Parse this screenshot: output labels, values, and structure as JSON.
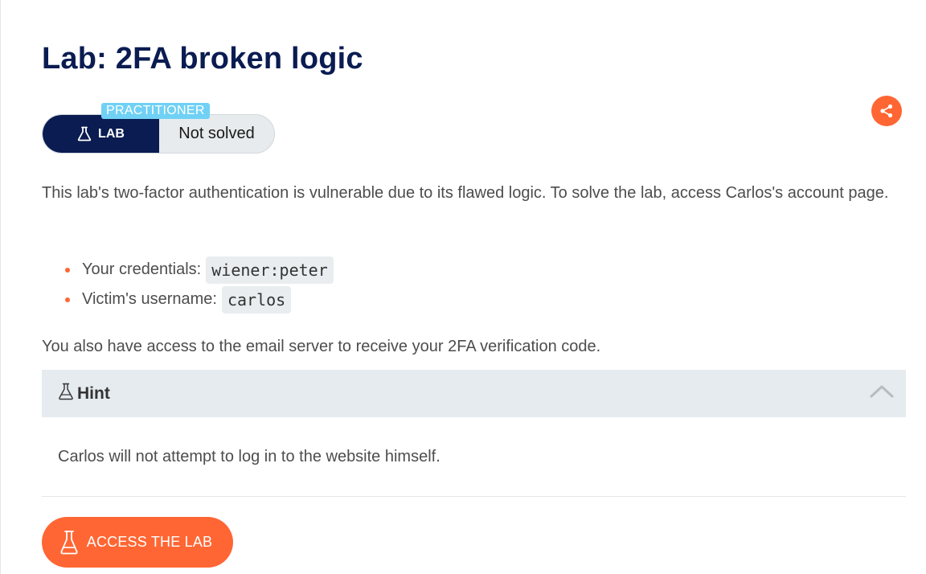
{
  "lab": {
    "title": "Lab: 2FA broken logic",
    "level": "PRACTITIONER",
    "tag": "LAB",
    "status": "Not solved",
    "description": "This lab's two-factor authentication is vulnerable due to its flawed logic. To solve the lab, access Carlos's account page.",
    "credentials": [
      {
        "label": "Your credentials:",
        "value": "wiener:peter"
      },
      {
        "label": "Victim's username:",
        "value": "carlos"
      }
    ],
    "email_note": "You also have access to the email server to receive your 2FA verification code.",
    "hint": {
      "title": "Hint",
      "body": "Carlos will not attempt to log in to the website himself.",
      "expanded": true
    },
    "access_button": "ACCESS THE LAB"
  },
  "icons": {
    "lab_tag": "flask-icon",
    "share": "share-icon",
    "hint": "flask-icon",
    "hint_toggle": "chevron-up-icon",
    "access": "flask-icon"
  },
  "colors": {
    "navy": "#0a1c51",
    "orange": "#ff6633",
    "level_badge": "#70d1f4",
    "hint_bg": "#e6ebef"
  }
}
